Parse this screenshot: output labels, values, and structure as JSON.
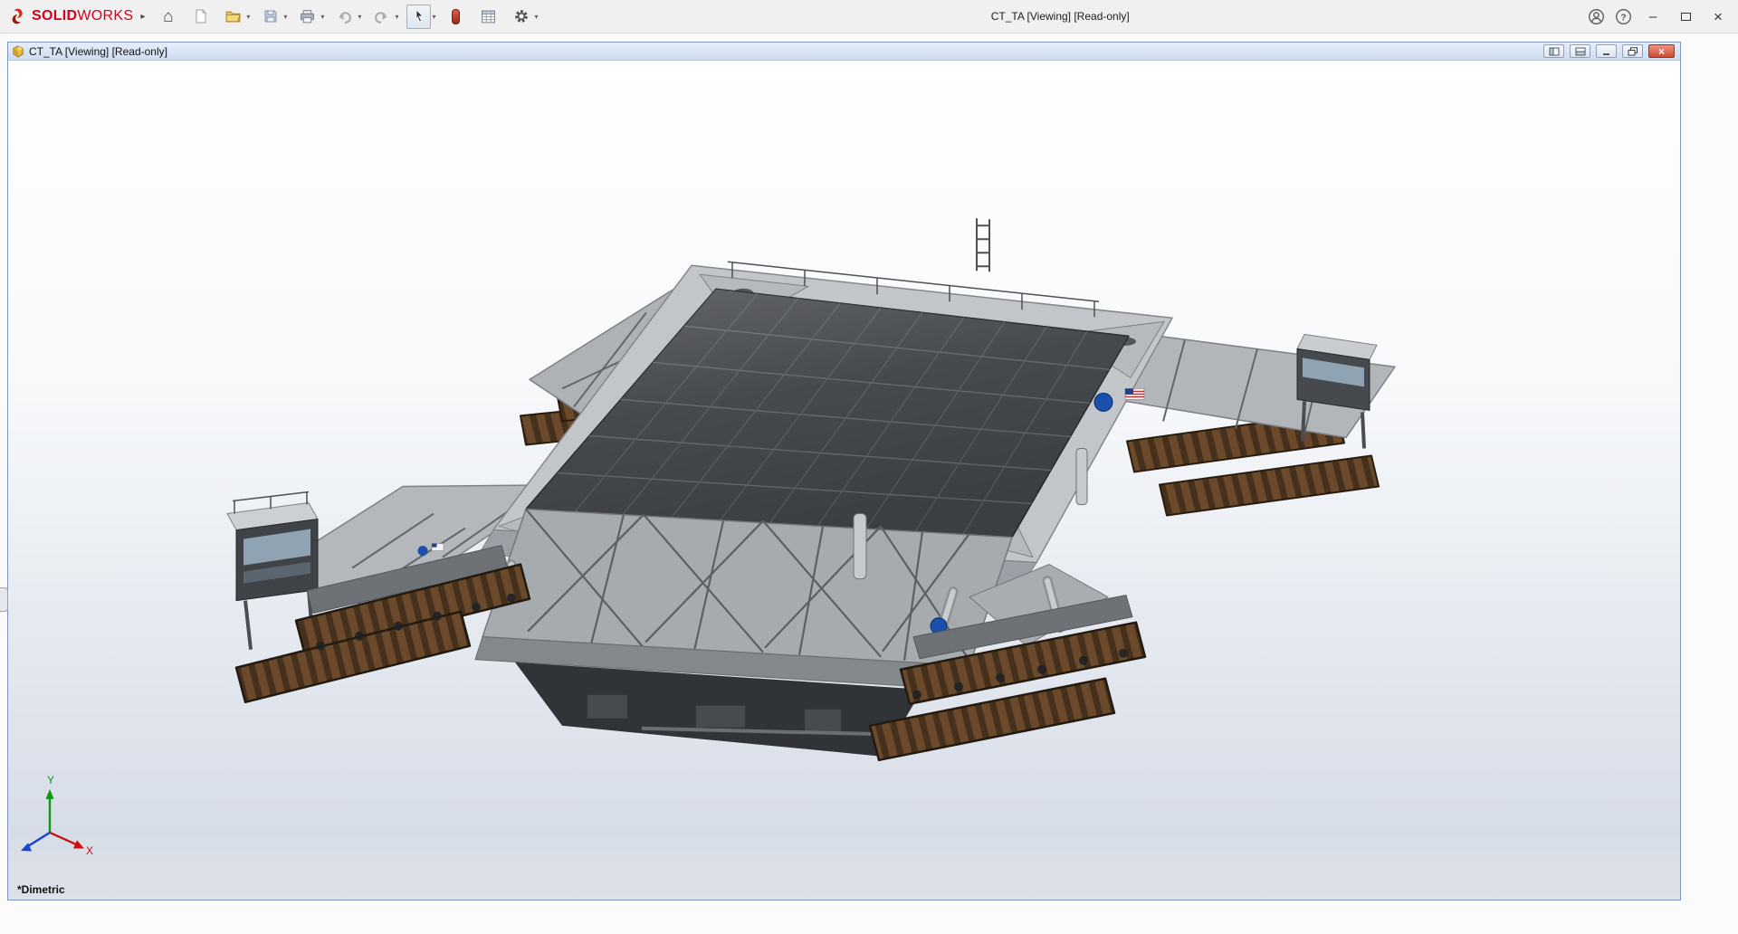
{
  "app": {
    "title": "CT_TA [Viewing] [Read-only]",
    "brand": {
      "solid": "SOLID",
      "works": "WORKS"
    }
  },
  "icons": {
    "flyout": "▸",
    "home": "⌂",
    "caret": "▾",
    "help": "?",
    "minimize": "–",
    "close": "×",
    "doc_close": "×"
  },
  "toolbar": {
    "buttons": [
      "home",
      "new-document",
      "open",
      "save",
      "print",
      "undo",
      "redo",
      "select",
      "snapshot",
      "bill-of-materials",
      "options"
    ]
  },
  "document": {
    "title": "CT_TA [Viewing] [Read-only]",
    "view_orientation": "*Dimetric",
    "axes": {
      "x": "X",
      "y": "Y"
    }
  },
  "colors": {
    "brand_red": "#d6001c",
    "doc_titlebar_top": "#e5eefb",
    "doc_titlebar_bottom": "#cfdcf0",
    "doc_border": "#7d96bd",
    "close_button_red": "#cc4a32",
    "viewport_gradient_top": "#ffffff",
    "viewport_gradient_bottom": "#d7dde8",
    "track_brown": "#6b4a2c",
    "track_dark": "#44301b",
    "deck_panel": "#3b3e42",
    "chassis_gray": "#b2b6ba",
    "nasa_blue": "#1a4faa",
    "axis_x_red": "#cc1111",
    "axis_y_green": "#0c9a0c",
    "axis_z_blue": "#1a46cc"
  }
}
